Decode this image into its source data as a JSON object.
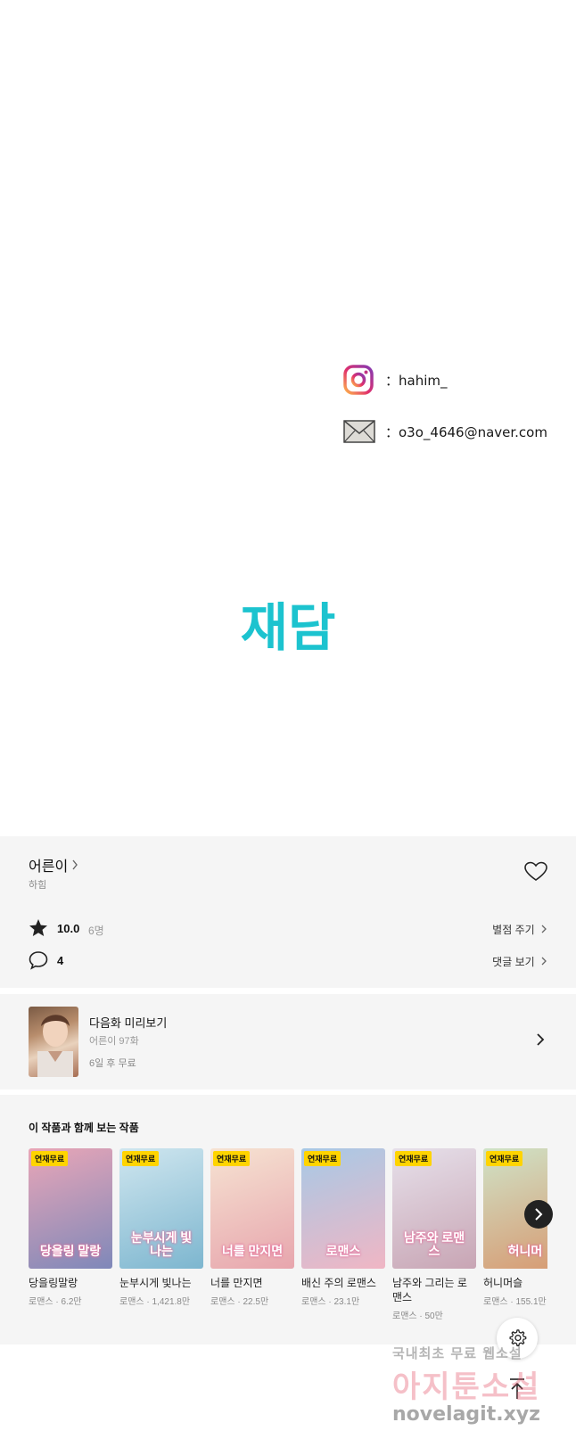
{
  "contact": {
    "instagram_text": "：hahim_",
    "email_text": "：o3o_4646@naver.com"
  },
  "logo_text": "재담",
  "work": {
    "title": "어른이",
    "author": "하힘",
    "rating": "10.0",
    "rating_count": "6명",
    "rate_link": "별점 주기",
    "comment_count": "4",
    "comment_link": "댓글 보기"
  },
  "next_episode": {
    "title": "다음화 미리보기",
    "subtitle": "어른이 97화",
    "free_text": "6일 후 무료"
  },
  "recommend": {
    "heading": "이 작품과 함께 보는 작품",
    "items": [
      {
        "badge": "연재무료",
        "title": "당을링말랑",
        "meta": "로맨스 · 6.2만",
        "cover_text": "당을링 말랑",
        "c1": "#e9a6b7",
        "c2": "#7f88b9"
      },
      {
        "badge": "연재무료",
        "title": "눈부시게 빛나는",
        "meta": "로맨스 · 1,421.8만",
        "cover_text": "눈부시게 빛나는",
        "c1": "#cfe6ef",
        "c2": "#7db6cf"
      },
      {
        "badge": "연재무료",
        "title": "너를 만지면",
        "meta": "로맨스 · 22.5만",
        "cover_text": "너를 만지면",
        "c1": "#f6e3d2",
        "c2": "#e7a5ad"
      },
      {
        "badge": "연재무료",
        "title": "배신 주의 로맨스",
        "meta": "로맨스 · 23.1만",
        "cover_text": "로맨스",
        "c1": "#a7c9e6",
        "c2": "#f0b6c4"
      },
      {
        "badge": "연재무료",
        "title": "남주와 그리는 로맨스",
        "meta": "로맨스 · 50만",
        "cover_text": "남주와 로맨스",
        "c1": "#e6e0ea",
        "c2": "#c8a5b4"
      },
      {
        "badge": "연재무료",
        "title": "허니머슬",
        "meta": "로맨스 · 155.1만",
        "cover_text": "허니머",
        "c1": "#cfe3c7",
        "c2": "#d79a72"
      }
    ]
  },
  "watermark": {
    "line1": "국내최초 무료 웹소설",
    "line2": "아지툰소설",
    "line3": "novelagit.xyz"
  },
  "colors": {
    "logo": "#1cc3cf",
    "badge": "#ffd400",
    "panel_bg": "#f5f5f5"
  }
}
